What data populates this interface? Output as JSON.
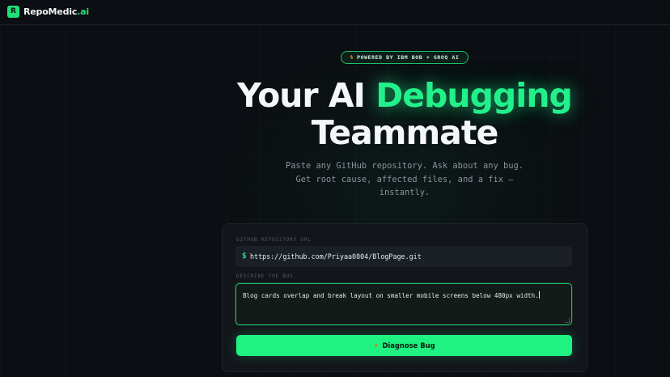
{
  "app": {
    "logo_letter": "R",
    "brand_name": "RepoMedic",
    "brand_suffix": ".ai"
  },
  "badge": {
    "icon": "lightning-bolt-icon",
    "text": "POWERED BY IBM BOB + GROQ AI"
  },
  "hero": {
    "line1_plain": "Your AI ",
    "line1_accent": "Debugging",
    "line2": "Teammate"
  },
  "subtitle": {
    "line1": "Paste any GitHub repository. Ask about any bug.",
    "line2": "Get root cause, affected files, and a fix —",
    "line3": "instantly."
  },
  "form": {
    "repo_label": "GITHUB REPOSITORY URL",
    "repo_prefix": "$",
    "repo_value": "https://github.com/Priyaa0804/BlogPage.git",
    "bug_label": "DESCRIBE THE BUG",
    "bug_value": "Blog cards overlap and break layout on smaller mobile screens below 480px width.",
    "submit_icon": "sparkle-icon",
    "submit_label": "Diagnose Bug"
  },
  "colors": {
    "accent": "#1fe07a",
    "background": "#0b0e12",
    "card": "#12161b"
  }
}
